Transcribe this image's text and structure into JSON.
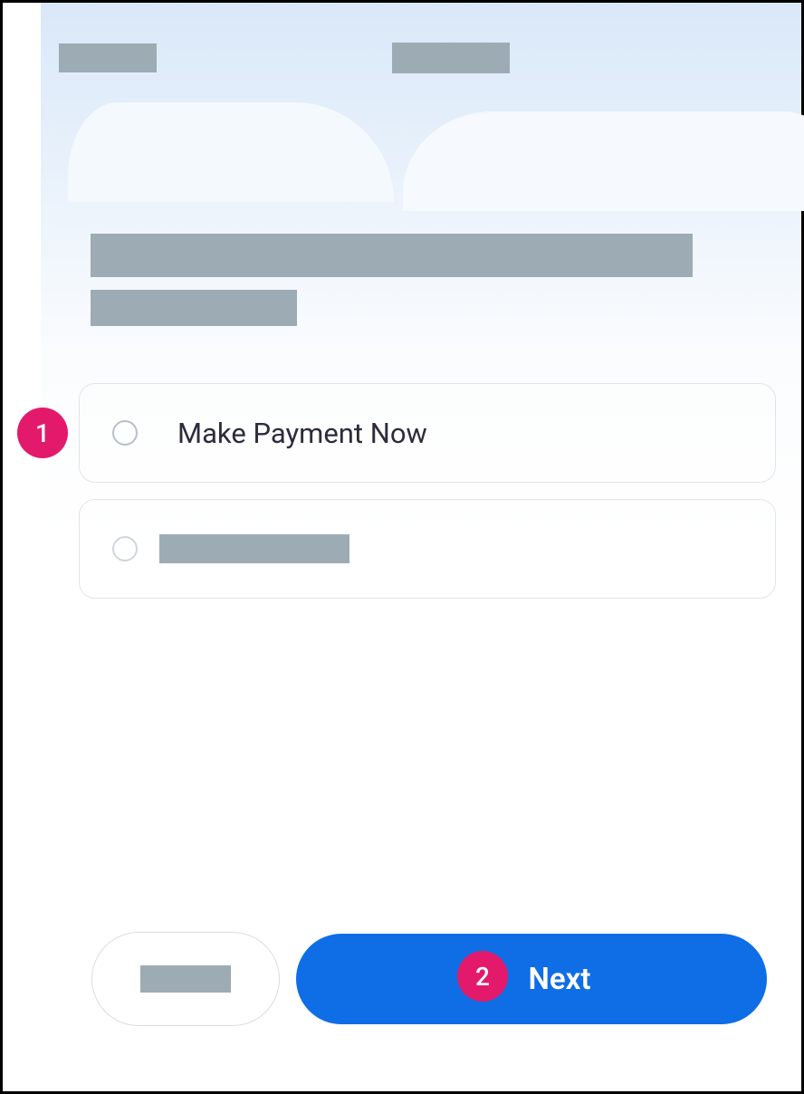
{
  "options": {
    "payment_now_label": "Make Payment Now"
  },
  "buttons": {
    "next_label": "Next"
  },
  "markers": {
    "m1": "1",
    "m2": "2"
  }
}
